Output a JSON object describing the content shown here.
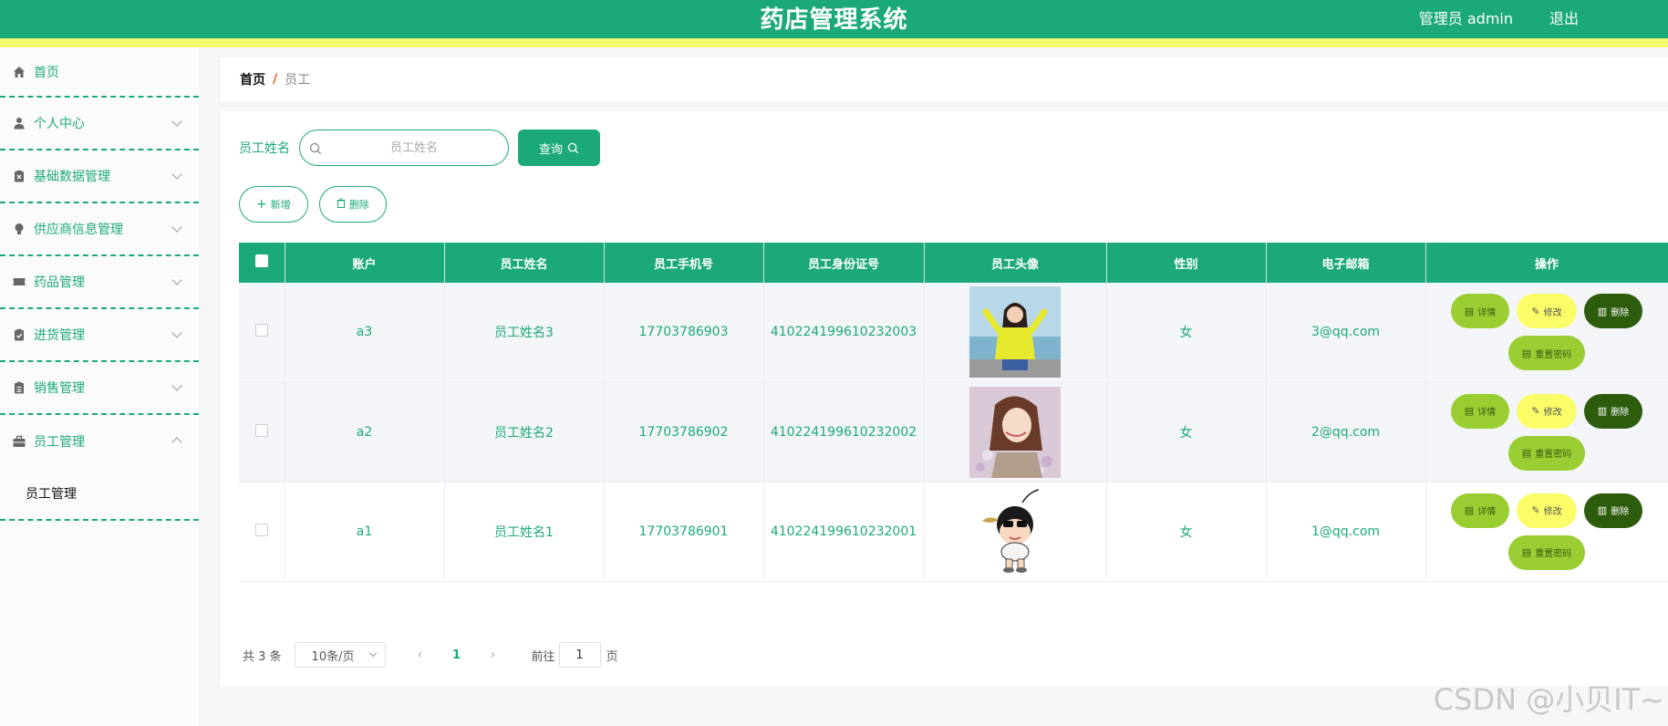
{
  "header": {
    "title": "药店管理系统",
    "user": "管理员 admin",
    "logout": "退出"
  },
  "sidebar": {
    "items": [
      {
        "label": "首页",
        "icon": "home-icon",
        "expandable": false
      },
      {
        "label": "个人中心",
        "icon": "user-icon",
        "expandable": true
      },
      {
        "label": "基础数据管理",
        "icon": "clipboard-x-icon",
        "expandable": true
      },
      {
        "label": "供应商信息管理",
        "icon": "bulb-icon",
        "expandable": true
      },
      {
        "label": "药品管理",
        "icon": "ticket-icon",
        "expandable": true
      },
      {
        "label": "进货管理",
        "icon": "clipboard-check-icon",
        "expandable": true
      },
      {
        "label": "销售管理",
        "icon": "clipboard-list-icon",
        "expandable": true
      },
      {
        "label": "员工管理",
        "icon": "briefcase-icon",
        "expandable": true,
        "open": true
      }
    ],
    "sub_item": "员工管理"
  },
  "breadcrumb": {
    "home": "首页",
    "separator": "/",
    "current": "员工"
  },
  "search": {
    "label": "员工姓名",
    "placeholder": "员工姓名",
    "value": "",
    "button": "查询"
  },
  "actions": {
    "add": "新增",
    "delete": "删除"
  },
  "table": {
    "columns": [
      "账户",
      "员工姓名",
      "员工手机号",
      "员工身份证号",
      "员工头像",
      "性别",
      "电子邮箱",
      "操作"
    ],
    "rows": [
      {
        "account": "a3",
        "name": "员工姓名3",
        "phone": "17703786903",
        "id_card": "410224199610232003",
        "avatar": "photo-woman-yellow",
        "gender": "女",
        "email": "3@qq.com"
      },
      {
        "account": "a2",
        "name": "员工姓名2",
        "phone": "17703786902",
        "id_card": "410224199610232002",
        "avatar": "photo-woman-flowers",
        "gender": "女",
        "email": "2@qq.com"
      },
      {
        "account": "a1",
        "name": "员工姓名1",
        "phone": "17703786901",
        "id_card": "410224199610232001",
        "avatar": "cartoon-boy",
        "gender": "女",
        "email": "1@qq.com"
      }
    ],
    "ops": {
      "detail": "详情",
      "edit": "修改",
      "delete": "删除",
      "reset": "重置密码"
    }
  },
  "pagination": {
    "total": "共 3 条",
    "page_size": "10条/页",
    "current_page": "1",
    "goto_label": "前往",
    "goto_value": "1",
    "goto_unit": "页"
  },
  "watermark": "CSDN @小贝IT~",
  "colors": {
    "primary": "#1ca97a",
    "stripe": "#f4fa6e",
    "detail": "#9acd32",
    "edit": "#fafc68",
    "delete": "#2d5c0c"
  }
}
